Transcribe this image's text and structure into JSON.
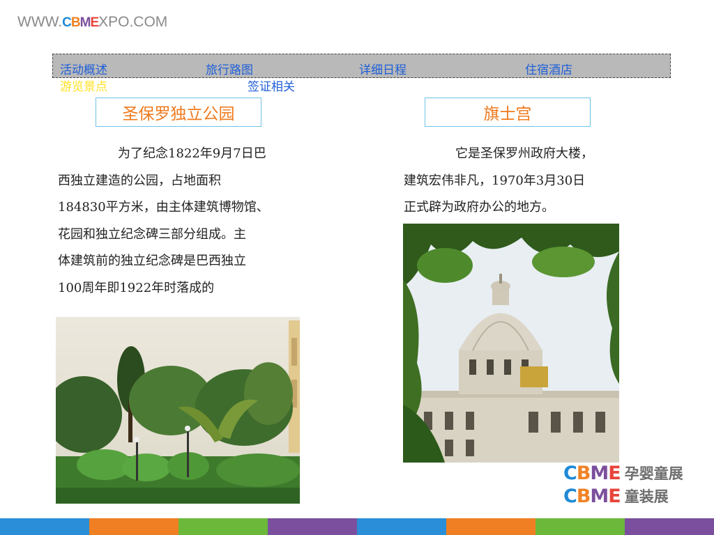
{
  "header": {
    "logo_prefix": "WWW.",
    "logo_brand_letters": [
      "C",
      "B",
      "M",
      "E"
    ],
    "logo_suffix": "XPO.COM"
  },
  "nav": {
    "items": [
      {
        "label": "活动概述",
        "active": false
      },
      {
        "label": "旅行路图",
        "active": false
      },
      {
        "label": "详细日程",
        "active": false
      },
      {
        "label": "住宿酒店",
        "active": false
      },
      {
        "label": "游览景点",
        "active": true
      },
      {
        "label": "签证相关",
        "active": false
      }
    ]
  },
  "left": {
    "title": "圣保罗独立公园",
    "lines": [
      "为了纪念1822年9月7日巴",
      "西独立建造的公园，占地面积",
      "184830平方米，由主体建筑博物馆、",
      "花园和独立纪念碑三部分组成。主",
      "体建筑前的独立纪念碑是巴西独立",
      "100周年即1922年时落成的"
    ]
  },
  "right": {
    "title": "旗士宫",
    "lines": [
      "它是圣保罗州政府大楼，",
      "建筑宏伟非凡，1970年3月30日",
      "正式辟为政府办公的地方。"
    ]
  },
  "brand": {
    "mark_letters": [
      "C",
      "B",
      "M",
      "E"
    ],
    "line1": "孕婴童展",
    "line2": "童装展"
  },
  "colors": {
    "title_orange": "#ef7a1e",
    "nav_link_blue": "#1f5fd8",
    "nav_active_yellow": "#ffe020",
    "footer": [
      "#2a8fd8",
      "#f07f23",
      "#6bb83a",
      "#7b4f9e",
      "#2a8fd8",
      "#f07f23",
      "#6bb83a",
      "#7b4f9e"
    ]
  }
}
